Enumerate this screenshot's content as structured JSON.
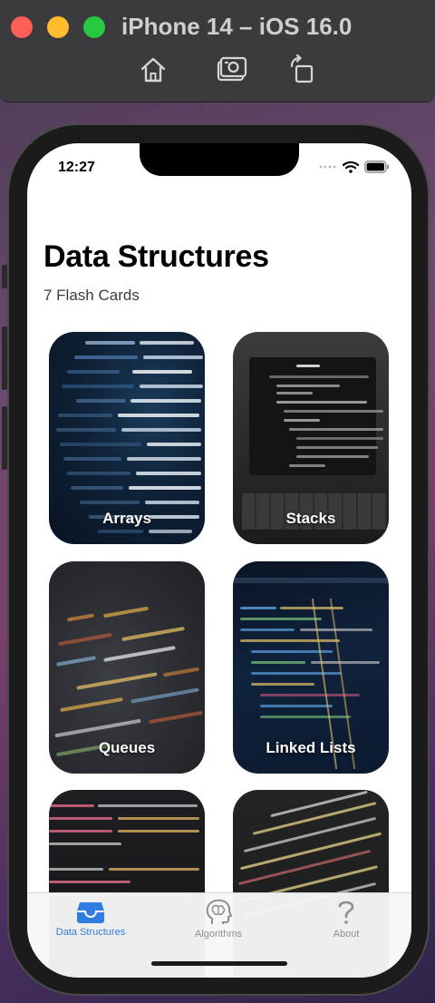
{
  "simulator": {
    "title": "iPhone 14 – iOS 16.0",
    "tools": [
      {
        "icon": "home-icon"
      },
      {
        "icon": "screenshot-icon"
      },
      {
        "icon": "rotate-icon"
      }
    ]
  },
  "status_bar": {
    "time": "12:27",
    "icons": [
      "signal-dots-icon",
      "wifi-icon",
      "battery-icon"
    ]
  },
  "header": {
    "title": "Data Structures",
    "subtitle": "7 Flash Cards"
  },
  "cards": [
    {
      "label": "Arrays"
    },
    {
      "label": "Stacks"
    },
    {
      "label": "Queues"
    },
    {
      "label": "Linked Lists"
    },
    {
      "label": ""
    },
    {
      "label": ""
    }
  ],
  "tabbar": {
    "selected": "Data Structures",
    "accent": "#2f7de1",
    "items": [
      {
        "label": "Data Structures",
        "icon": "tray-icon"
      },
      {
        "label": "Algorithms",
        "icon": "brain-head-icon"
      },
      {
        "label": "About",
        "icon": "question-mark-icon"
      }
    ]
  }
}
